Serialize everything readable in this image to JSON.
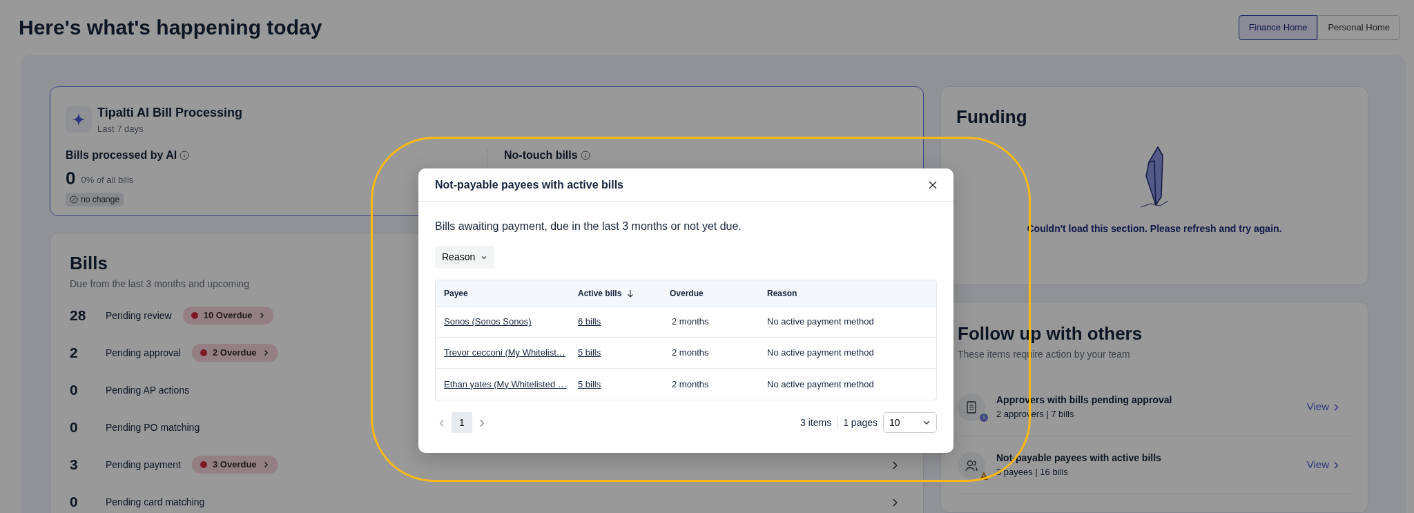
{
  "header": {
    "title": "Here's what's happening today",
    "views": [
      {
        "label": "Finance Home",
        "selected": true
      },
      {
        "label": "Personal Home",
        "selected": false
      }
    ]
  },
  "ai_card": {
    "title": "Tipalti AI Bill Processing",
    "subtitle": "Last 7 days",
    "metrics": [
      {
        "label": "Bills processed by AI",
        "value": "0",
        "caption": "0% of all bills",
        "change": "no change"
      },
      {
        "label": "No-touch bills"
      }
    ]
  },
  "bills": {
    "title": "Bills",
    "subtitle": "Due from the last 3 months and upcoming",
    "rows": [
      {
        "count": "28",
        "label": "Pending review",
        "overdue": "10 Overdue"
      },
      {
        "count": "2",
        "label": "Pending approval",
        "overdue": "2 Overdue"
      },
      {
        "count": "0",
        "label": "Pending AP actions"
      },
      {
        "count": "0",
        "label": "Pending PO matching"
      },
      {
        "count": "3",
        "label": "Pending payment",
        "overdue": "3 Overdue"
      },
      {
        "count": "0",
        "label": "Pending card matching"
      }
    ]
  },
  "funding": {
    "title": "Funding",
    "error": "Couldn't load this section. Please refresh and try again."
  },
  "follow_up": {
    "title": "Follow up with others",
    "subtitle": "These items require action by your team",
    "items": [
      {
        "kind": "approvers",
        "title": "Approvers with bills pending approval",
        "detail": "2 approvers | 7 bills",
        "link": "View"
      },
      {
        "kind": "payees",
        "title": "Not-payable payees with active bills",
        "detail": "3 payees | 16 bills",
        "link": "View"
      }
    ]
  },
  "modal": {
    "title": "Not-payable payees with active bills",
    "description": "Bills awaiting payment, due in the last 3 months or not yet due.",
    "filter": "Reason",
    "columns": [
      {
        "label": "Payee",
        "sorted": false
      },
      {
        "label": "Active bills",
        "sorted": true
      },
      {
        "label": "Overdue",
        "sorted": false
      },
      {
        "label": "Reason",
        "sorted": false
      }
    ],
    "rows": [
      {
        "payee": "Sonos (Sonos Sonos)",
        "active_bills": "6 bills",
        "overdue": "2 months",
        "reason": "No active payment method"
      },
      {
        "payee": "Trevor cecconi (My Whitelist…",
        "active_bills": "5 bills",
        "overdue": "2 months",
        "reason": "No active payment method"
      },
      {
        "payee": "Ethan yates (My Whitelisted …",
        "active_bills": "5 bills",
        "overdue": "2 months",
        "reason": "No active payment method"
      }
    ],
    "pagination": {
      "pages": [
        {
          "label": "1",
          "selected": true
        }
      ],
      "items": "3 items",
      "page_count": "1 pages",
      "page_size": "10"
    }
  }
}
